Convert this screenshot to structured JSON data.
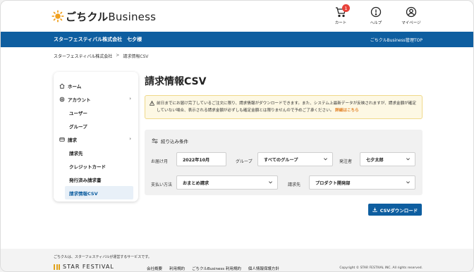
{
  "header": {
    "logo_main": "ごちクル",
    "logo_sub": "Business",
    "cart_label": "カート",
    "cart_count": "1",
    "help_label": "ヘルプ",
    "mypage_label": "マイページ"
  },
  "bluebar": {
    "company": "スターフェスティバル株式会社　七夕様",
    "admin_link": "ごちクルBusiness管理TOP"
  },
  "breadcrumb": {
    "root": "スターフェスティバル株式会社",
    "sep": ">",
    "current": "請求情報CSV"
  },
  "sidebar": {
    "home": "ホーム",
    "account": "アカウント",
    "account_children": [
      "ユーザー",
      "グループ"
    ],
    "billing": "請求",
    "billing_children": [
      "請求先",
      "クレジットカード",
      "発行済み請求書",
      "請求情報CSV"
    ],
    "chevron": "›"
  },
  "main": {
    "title": "請求情報CSV",
    "notice_text": "前日までにお届け完了しているご注文に限り、請求情報がダウンロードできます。また、システム上最新データが反映されますが、請求金額が確定していない場合、表示される請求金額が必ずしも確定金額とは限りませんので予めご了承ください。",
    "notice_link": "詳細はこちら",
    "filter_title": "絞り込み条件",
    "filters": {
      "delivery_month_label": "お届け月",
      "delivery_month_value": "2022年10月",
      "group_label": "グループ",
      "group_value": "すべてのグループ",
      "orderer_label": "発注者",
      "orderer_value": "七夕太郎",
      "payment_label": "支払い方法",
      "payment_value": "おまとめ請求",
      "billing_label": "請求先",
      "billing_value": "プロダクト開発部"
    },
    "csv_button": "CSVダウンロード"
  },
  "footer": {
    "note": "ごちクルは、スターフェスティバルが運営するサービスです。",
    "brand": "STAR FESTIVAL",
    "links": [
      "会社概要",
      "利用規約",
      "ごちクルBusiness 利用規約",
      "個人情報保護方針"
    ],
    "copyright": "Copyright © STAR FESTIVAL INC. All rights reserved."
  },
  "colors": {
    "primary": "#0e5ea0",
    "accent": "#f0a01e",
    "badge": "#e8423a",
    "notice_bg": "#fdf8e4"
  }
}
